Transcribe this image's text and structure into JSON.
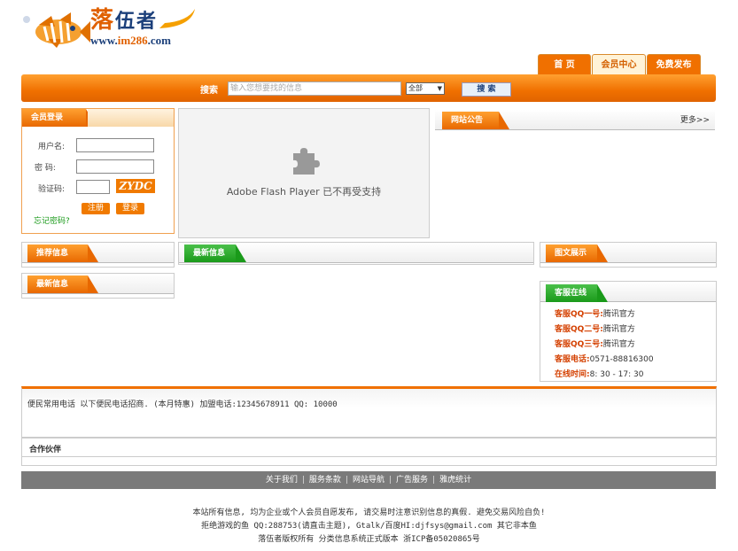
{
  "header": {
    "logo_cn_1": "落",
    "logo_cn_2": "伍者",
    "logo_url_prefix": "www.",
    "logo_url_domain": "im286",
    "logo_url_suffix": ".com"
  },
  "nav_tabs": {
    "home": "首  页",
    "member": "会员中心",
    "publish": "免费发布"
  },
  "search": {
    "label": "搜索",
    "placeholder": "输入您想要找的信息",
    "select_value": "全部",
    "button": "搜 索"
  },
  "login": {
    "title": "会员登录",
    "username_label": "用户名:",
    "password_label": "密  码:",
    "captcha_label": "验证码:",
    "captcha_text": "ZYDC",
    "register_button": "注册",
    "login_button": "登录",
    "forgot_link": "忘记密码?"
  },
  "flash": {
    "message": "Adobe Flash Player 已不再受支持"
  },
  "announcement": {
    "title": "网站公告",
    "more": "更多>>"
  },
  "recommended": {
    "title": "推荐信息"
  },
  "latest_center": {
    "title": "最新信息"
  },
  "latest_left": {
    "title": "最新信息"
  },
  "gallery": {
    "title": "图文展示"
  },
  "kefu": {
    "title": "客服在线",
    "lines": [
      {
        "key": "客服QQ一号:",
        "value": "腾讯官方"
      },
      {
        "key": "客服QQ二号:",
        "value": "腾讯官方"
      },
      {
        "key": "客服QQ三号:",
        "value": "腾讯官方"
      },
      {
        "key": "客服电话:",
        "value": "0571-88816300"
      },
      {
        "key": "在线时间:",
        "value": "8: 30 - 17: 30"
      }
    ]
  },
  "notice": {
    "text": "便民常用电话 以下便民电话招商. (本月特惠) 加盟电话:12345678911 QQ: 10000"
  },
  "partners": {
    "title": "合作伙伴"
  },
  "footer_nav": {
    "items": [
      "关于我们",
      "服务条款",
      "网站导航",
      "广告服务",
      "雅虎统计"
    ]
  },
  "footer": {
    "line1": "本站所有信息, 均为企业或个人会员自愿发布, 请交易时注意识别信息的真假. 避免交易风险自负!",
    "line2": "拒绝游戏的鱼 QQ:288753(请直击主题), Gtalk/百度HI:djfsys@gmail.com 其它非本鱼",
    "line3": "落伍者版权所有 分类信息系统正式版本 浙ICP备05020865号"
  },
  "colors": {
    "accent_orange": "#f07000",
    "accent_green": "#1a9a1a",
    "brand_blue": "#1b3f7a"
  }
}
